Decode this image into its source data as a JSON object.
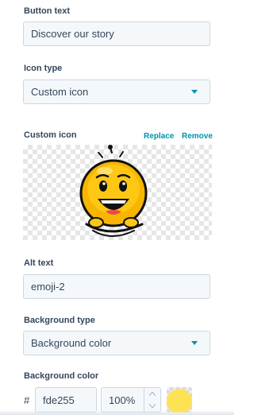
{
  "button_text": {
    "label": "Button text",
    "value": "Discover our story"
  },
  "icon_type": {
    "label": "Icon type",
    "selected": "Custom icon"
  },
  "custom_icon": {
    "label": "Custom icon",
    "replace_label": "Replace",
    "remove_label": "Remove",
    "icon_name": "emoji-smiley-icon"
  },
  "alt_text": {
    "label": "Alt text",
    "value": "emoji-2"
  },
  "background_type": {
    "label": "Background type",
    "selected": "Background color"
  },
  "background_color": {
    "label": "Background color",
    "hash": "#",
    "hex_value": "fde255",
    "opacity_value": "100%",
    "swatch_color": "#fde255"
  },
  "colors": {
    "accent": "#0091ae",
    "text": "#33475b",
    "field_bg": "#f5f8fa",
    "field_border": "#cbd6e2"
  }
}
